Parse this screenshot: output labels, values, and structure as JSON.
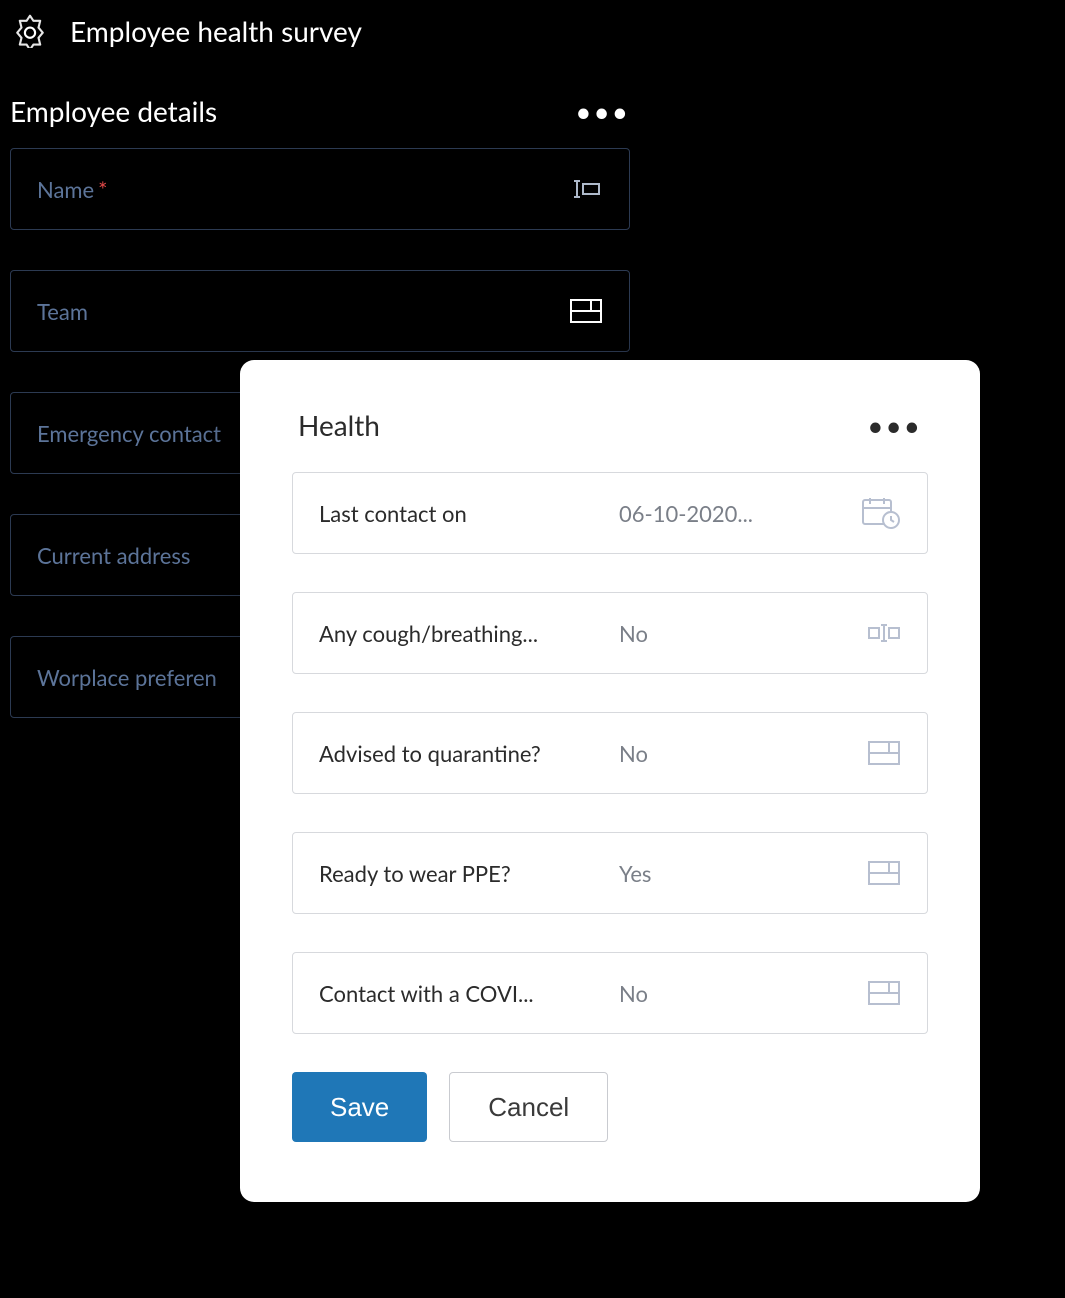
{
  "header": {
    "title": "Employee health survey"
  },
  "employeeDetails": {
    "title": "Employee details",
    "fields": {
      "name": {
        "label": "Name",
        "required": "*"
      },
      "team": {
        "label": "Team"
      },
      "emergency": {
        "label": "Emergency contact"
      },
      "address": {
        "label": "Current address"
      },
      "workplace": {
        "label": "Worplace preferen"
      }
    }
  },
  "health": {
    "title": "Health",
    "fields": {
      "lastContact": {
        "label": "Last contact on",
        "value": "06-10-2020..."
      },
      "cough": {
        "label": "Any cough/breathing...",
        "value": "No"
      },
      "quarantine": {
        "label": "Advised to quarantine?",
        "value": "No"
      },
      "ppe": {
        "label": "Ready to wear PPE?",
        "value": "Yes"
      },
      "covidContact": {
        "label": "Contact with a COVI...",
        "value": "No"
      }
    },
    "actions": {
      "save": "Save",
      "cancel": "Cancel"
    }
  }
}
